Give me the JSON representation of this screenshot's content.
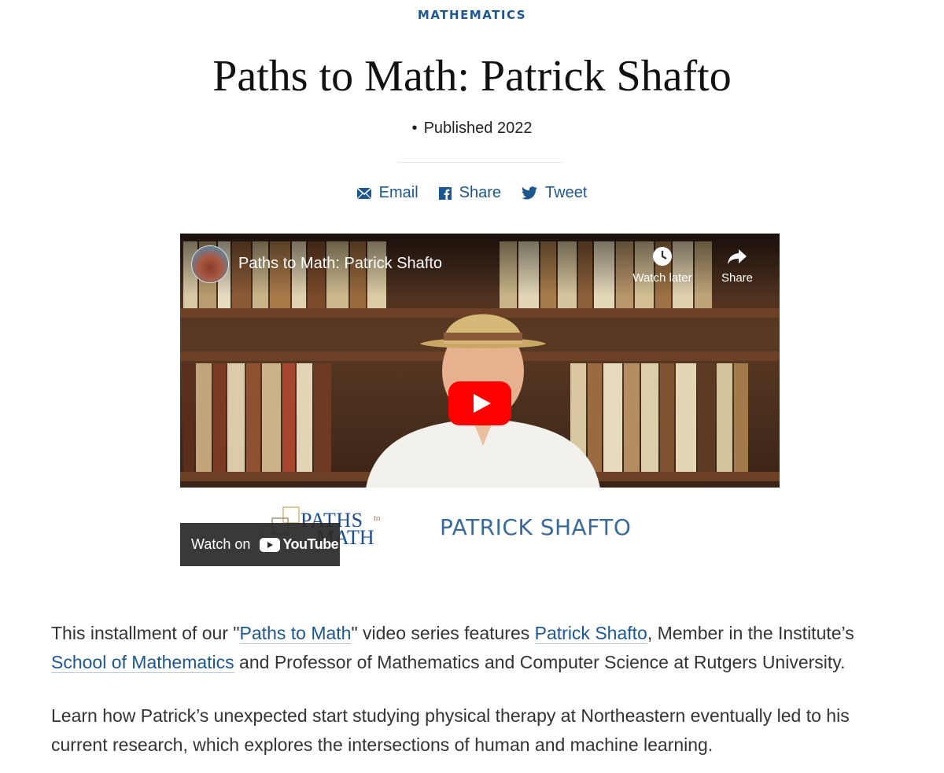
{
  "header": {
    "category": "MATHEMATICS",
    "title": "Paths to Math: Patrick Shafto",
    "published": "Published 2022"
  },
  "share": {
    "email": "Email",
    "facebook": "Share",
    "twitter": "Tweet"
  },
  "video": {
    "title": "Paths to Math: Patrick Shafto",
    "watch_later": "Watch later",
    "share": "Share",
    "watch_on": "Watch on",
    "youtube": "YouTube",
    "logo_line1": "PATHS",
    "logo_to": "to",
    "logo_line2": "MATH",
    "name_card": "PATRICK SHAFTO"
  },
  "body": {
    "p1": {
      "t1": "This installment of our \"",
      "link1": "Paths to Math",
      "t2": "\" video series features ",
      "link2": "Patrick Shafto",
      "t3": ", Member in the Institute’s ",
      "link3": "School of Mathematics",
      "t4": " and Professor of Mathematics and Computer Science at Rutgers University."
    },
    "p2": "Learn how Patrick’s unexpected start studying physical therapy at Northeastern eventually led to his current research, which explores the intersections of human and machine learning."
  },
  "colors": {
    "accent": "#1d5790",
    "youtube_red": "#ff0000"
  }
}
